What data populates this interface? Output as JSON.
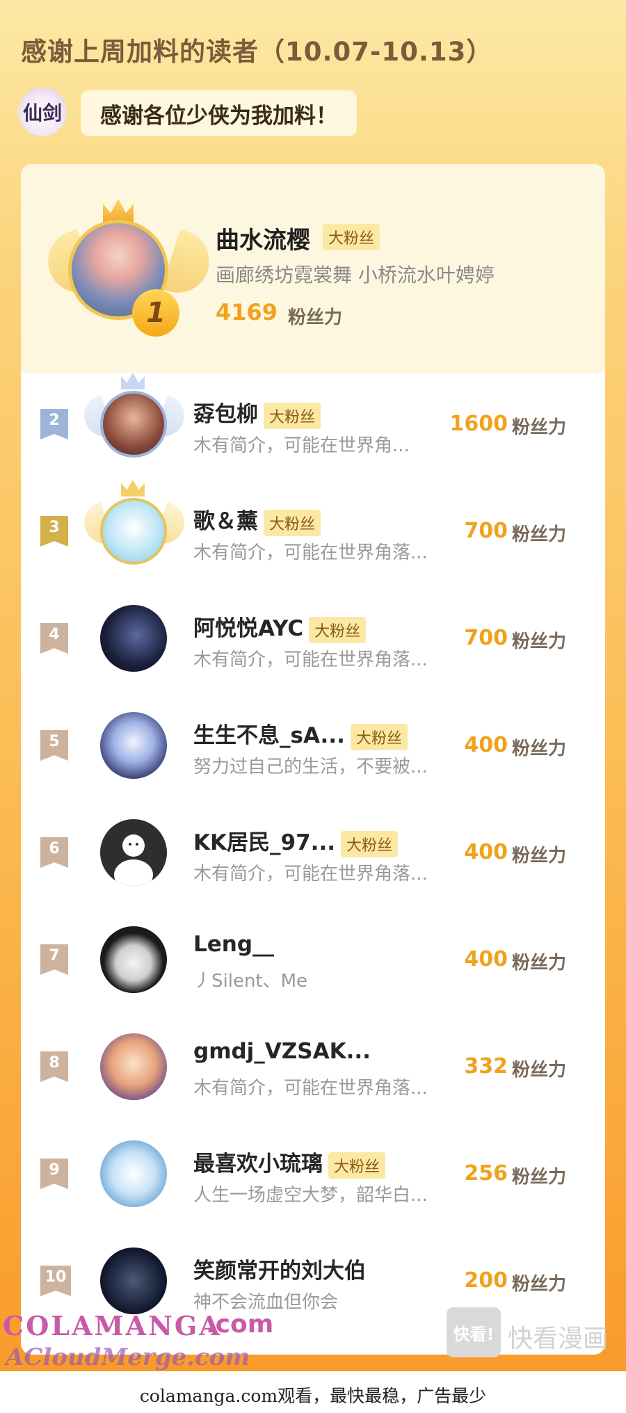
{
  "header": {
    "title": "感谢上周加料的读者（10.07-10.13）",
    "sponsor_logo_text": "仙剑",
    "thanks_text": "感谢各位少侠为我加料！"
  },
  "first_place": {
    "rank": "1",
    "name": "曲水流樱",
    "tag": "大粉丝",
    "bio": "画廊绣坊霓裳舞 小桥流水叶娉婷",
    "score": "4169",
    "score_unit": "粉丝力"
  },
  "rows": [
    {
      "rank": "2",
      "name": "孬包柳",
      "tag": "大粉丝",
      "bio": "木有简介，可能在世界角...",
      "score": "1600",
      "unit": "粉丝力"
    },
    {
      "rank": "3",
      "name": "歌＆薰",
      "tag": "大粉丝",
      "bio": "木有简介，可能在世界角落...",
      "score": "700",
      "unit": "粉丝力"
    },
    {
      "rank": "4",
      "name": "阿悦悦AYC",
      "tag": "大粉丝",
      "bio": "木有简介，可能在世界角落...",
      "score": "700",
      "unit": "粉丝力"
    },
    {
      "rank": "5",
      "name": "生生不息_sA...",
      "tag": "大粉丝",
      "bio": "努力过自己的生活，不要被...",
      "score": "400",
      "unit": "粉丝力"
    },
    {
      "rank": "6",
      "name": "KK居民_97...",
      "tag": "大粉丝",
      "bio": "木有简介，可能在世界角落...",
      "score": "400",
      "unit": "粉丝力"
    },
    {
      "rank": "7",
      "name": "Leng__",
      "tag": "",
      "bio": "丿Silent、Me",
      "score": "400",
      "unit": "粉丝力"
    },
    {
      "rank": "8",
      "name": "gmdj_VZSAK...",
      "tag": "",
      "bio": "木有简介，可能在世界角落...",
      "score": "332",
      "unit": "粉丝力"
    },
    {
      "rank": "9",
      "name": "最喜欢小琉璃",
      "tag": "大粉丝",
      "bio": "人生一场虚空大梦，韶华白...",
      "score": "256",
      "unit": "粉丝力"
    },
    {
      "rank": "10",
      "name": "笑颜常开的刘大伯",
      "tag": "",
      "bio": "神不会流血但你会",
      "score": "200",
      "unit": "粉丝力"
    }
  ],
  "watermarks": {
    "left_top": "COLAMANGA",
    "left_com": ".com",
    "left_bottom": "ACloudMerge.com",
    "right_logo": "快看!",
    "right_text": "快看漫画"
  },
  "footer": {
    "text": "colamanga.com观看，最快最稳，广告最少"
  },
  "colors": {
    "accent": "#f0a21d",
    "tag_bg": "#fbe8a4",
    "bg_top": "#fce9a5",
    "bg_bottom": "#f99b2b"
  }
}
